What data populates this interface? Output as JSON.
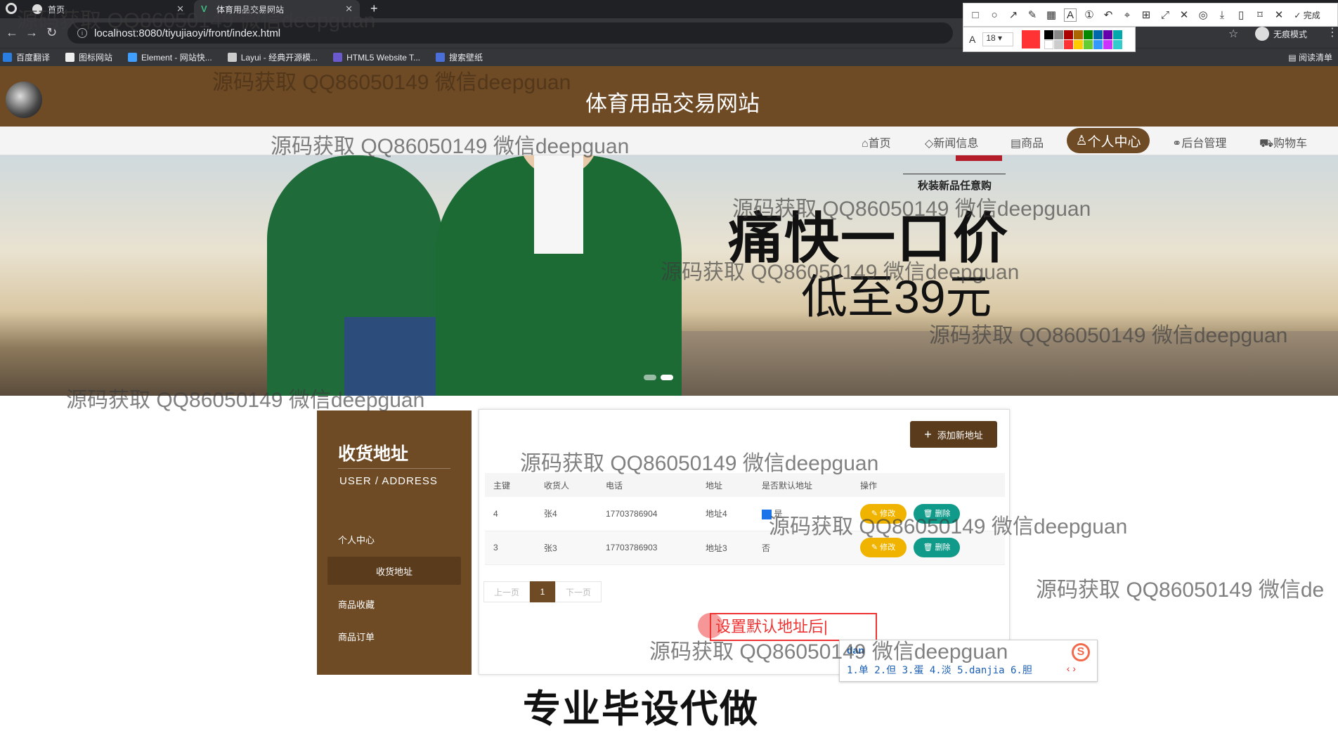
{
  "browser": {
    "tabs": [
      {
        "label": "首页",
        "active": false
      },
      {
        "label": "体育用品交易网站",
        "active": true
      }
    ],
    "url": "localhost:8080/tiyujiaoyi/front/index.html",
    "incognito_label": "无痕模式",
    "bookmarks": [
      "百度翻译",
      "图标网站",
      "Element - 网站快...",
      "Layui - 经典开源模...",
      "HTML5 Website T...",
      "搜索壁纸"
    ],
    "reading_list": "阅读清单"
  },
  "snip_toolbar": {
    "done_label": "完成",
    "font_size": "18",
    "font_icon": "A"
  },
  "site": {
    "title": "体育用品交易网站"
  },
  "nav": {
    "home": "首页",
    "news": "新闻信息",
    "goods": "商品",
    "profile": "个人中心",
    "admin": "后台管理",
    "cart": "购物车"
  },
  "banner": {
    "line1": "秋装新品任意购",
    "line2": "痛快一口价",
    "line3": "低至39元"
  },
  "sidebar": {
    "title": "收货地址",
    "subtitle": "USER / ADDRESS",
    "items": [
      "个人中心",
      "收货地址",
      "商品收藏",
      "商品订单"
    ],
    "active_index": 1
  },
  "address": {
    "add_button": "添加新地址",
    "columns": [
      "主键",
      "收货人",
      "电话",
      "地址",
      "是否默认地址",
      "操作"
    ],
    "rows": [
      {
        "id": "4",
        "name": "张4",
        "phone": "17703786904",
        "addr": "地址4",
        "default": "是"
      },
      {
        "id": "3",
        "name": "张3",
        "phone": "17703786903",
        "addr": "地址3",
        "default": "否"
      }
    ],
    "edit_label": "修改",
    "delete_label": "删除",
    "pager": {
      "prev": "上一页",
      "current": "1",
      "next": "下一页"
    }
  },
  "annotation": {
    "text": "设置默认地址后"
  },
  "ime": {
    "pinyin": "dan",
    "candidates": "1.单 2.但 3.蛋 4.淡 5.danjia 6.胆",
    "logo": "S"
  },
  "watermark": "源码获取 QQ86050149 微信deepguan",
  "watermark_cut": "源码获取 QQ86050149 微信de",
  "footer": "专业毕设代做",
  "colors": {
    "brand": "#6e4a25",
    "brand_dark": "#5a3c1d",
    "edit": "#f0b400",
    "delete": "#0f9a89",
    "annotation": "#e33333"
  }
}
